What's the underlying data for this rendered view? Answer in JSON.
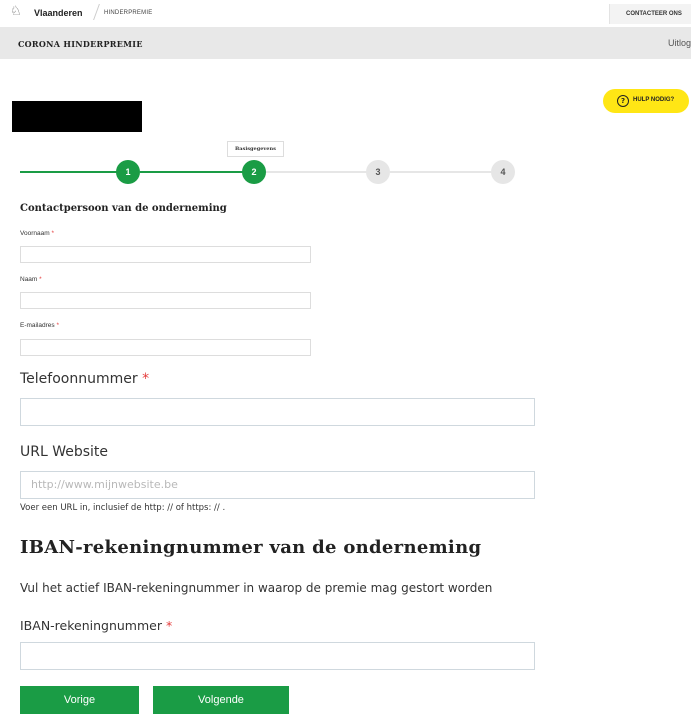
{
  "header": {
    "brand": "Vlaanderen",
    "breadcrumb": "HINDERPREMIE",
    "contact": "CONTACTEER ONS",
    "app_title": "CORONA HINDERPREMIE",
    "logout": "Uitlog"
  },
  "help": {
    "label": "HULP NODIG?"
  },
  "steps": {
    "active_label": "Basisgegevens",
    "items": [
      "1",
      "2",
      "3",
      "4"
    ]
  },
  "contact_section": {
    "title": "Contactpersoon van de onderneming",
    "first_name_label": "Voornaam",
    "last_name_label": "Naam",
    "email_label": "E-mailadres",
    "phone_label": "Telefoonnummer",
    "website_label": "URL Website",
    "website_placeholder": "http://www.mijnwebsite.be",
    "website_hint": "Voer een URL in, inclusief de http: // of https: // ."
  },
  "iban_section": {
    "title": "IBAN-rekeningnummer van de onderneming",
    "description": "Vul het actief IBAN-rekeningnummer in waarop de premie mag gestort worden",
    "iban_label": "IBAN-rekeningnummer"
  },
  "required_marker": "*",
  "buttons": {
    "previous": "Vorige",
    "next": "Volgende"
  },
  "colors": {
    "primary_green": "#1a9c45",
    "help_yellow": "#ffe615",
    "required_red": "#e53b3b"
  }
}
